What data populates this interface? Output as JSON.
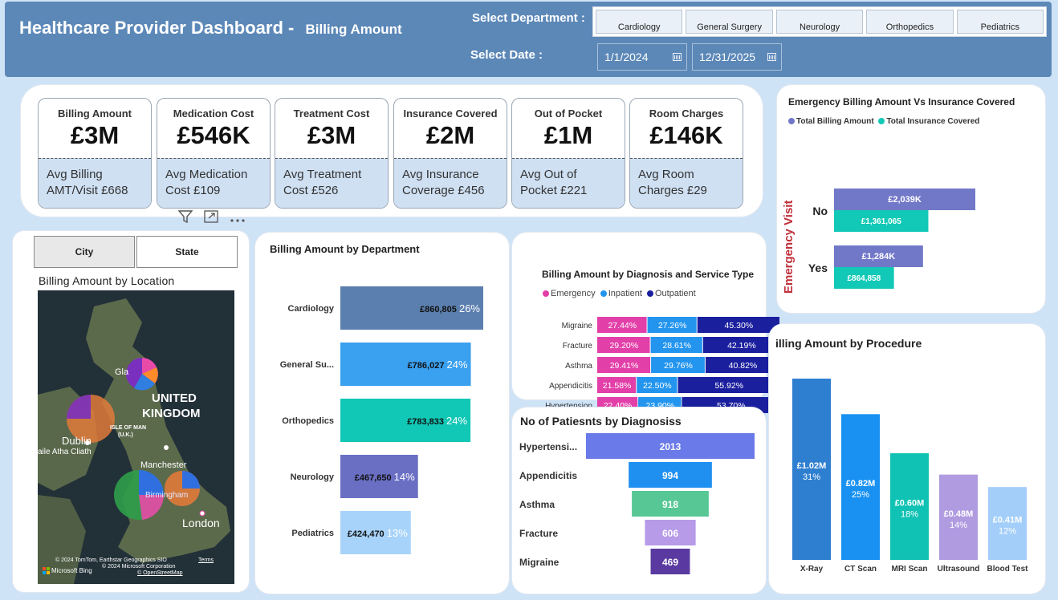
{
  "header": {
    "title_main": "Healthcare Provider Dashboard -",
    "title_sub": "Billing Amount",
    "select_department_label": "Select Department :",
    "select_date_label": "Select Date :",
    "departments": [
      "Cardiology",
      "General Surgery",
      "Neurology",
      "Orthopedics",
      "Pediatrics"
    ],
    "date_start": "1/1/2024",
    "date_end": "12/31/2025"
  },
  "kpis": [
    {
      "title": "Billing Amount",
      "value": "£3M",
      "avg": "Avg Billing AMT/Visit £668"
    },
    {
      "title": "Medication Cost",
      "value": "£546K",
      "avg": "Avg Medication Cost £109"
    },
    {
      "title": "Treatment Cost",
      "value": "£3M",
      "avg": "Avg Treatment Cost £526"
    },
    {
      "title": "Insurance Covered",
      "value": "£2M",
      "avg": "Avg Insurance Coverage £456"
    },
    {
      "title": "Out of Pocket",
      "value": "£1M",
      "avg": "Avg Out of Pocket £221"
    },
    {
      "title": "Room Charges",
      "value": "£146K",
      "avg": "Avg Room Charges £29"
    }
  ],
  "location": {
    "tabs": [
      "City",
      "State"
    ],
    "title": "Billing Amount by Location",
    "map_labels": {
      "uk1": "UNITED",
      "uk2": "KINGDOM",
      "isle1": "ISLE OF MAN",
      "isle2": "(U.K.)",
      "dublin": "Dublin",
      "baile": "aile Atha Cliath",
      "manchester": "Manchester",
      "birm": "Birmingham",
      "london": "London",
      "gla": "Gla",
      "copy1": "© 2024 TomTom, Earthstar Geographics SIO",
      "copy2": "© 2024 Microsoft Corporation",
      "terms": "Terms",
      "osm": "© OpenStreetMap",
      "bing": "Microsoft Bing"
    }
  },
  "colors": {
    "cardiology": "#5b7fae",
    "general_surgery": "#3aa0f0",
    "orthopedics": "#11c7b5",
    "neurology": "#6a6fc4",
    "pediatrics": "#a7d3fa",
    "emergency": "#e23fa8",
    "inpatient": "#2395ef",
    "outpatient": "#1a1f9e",
    "billing_total": "#7278c8",
    "insurance_total": "#12c9b7"
  },
  "chart_data": [
    {
      "type": "bar",
      "title": "Billing Amount by Department",
      "categories": [
        "Cardiology",
        "General Su...",
        "Orthopedics",
        "Neurology",
        "Pediatrics"
      ],
      "values": [
        860805,
        786027,
        783833,
        467650,
        424470
      ],
      "labels": [
        "£860,805",
        "£786,027",
        "£783,833",
        "£467,650",
        "£424,470"
      ],
      "percents": [
        "26%",
        "24%",
        "24%",
        "14%",
        "13%"
      ]
    },
    {
      "type": "bar",
      "title": "Billing Amount by Diagnosis and Service Type",
      "legend": [
        "Emergency",
        "Inpatient",
        "Outpatient"
      ],
      "categories": [
        "Migraine",
        "Fracture",
        "Asthma",
        "Appendicitis",
        "Hypertension"
      ],
      "series": [
        {
          "name": "Emergency",
          "values": [
            27.44,
            29.2,
            29.41,
            21.58,
            22.4
          ]
        },
        {
          "name": "Inpatient",
          "values": [
            27.26,
            28.61,
            29.76,
            22.5,
            23.9
          ]
        },
        {
          "name": "Outpatient",
          "values": [
            45.3,
            42.19,
            40.82,
            55.92,
            53.7
          ]
        }
      ]
    },
    {
      "type": "bar",
      "title": "No of Patiesnts by Diagnosiss",
      "categories": [
        "Hypertensi...",
        "Appendicitis",
        "Asthma",
        "Fracture",
        "Migraine"
      ],
      "values": [
        2013,
        994,
        918,
        606,
        469
      ],
      "colors": [
        "#6a7ae8",
        "#1f8ff0",
        "#57c795",
        "#b79ae8",
        "#5a3aa0"
      ]
    },
    {
      "type": "bar",
      "title": "Emergency Billing Amount Vs Insurance Covered",
      "axis_label": "Emergency Visit",
      "legend": [
        "Total Billing Amount",
        "Total Insurance Covered"
      ],
      "categories": [
        "No",
        "Yes"
      ],
      "series": [
        {
          "name": "Total Billing Amount",
          "values": [
            2039000,
            1284000
          ],
          "labels": [
            "£2,039K",
            "£1,284K"
          ]
        },
        {
          "name": "Total Insurance Covered",
          "values": [
            1361065,
            864858
          ],
          "labels": [
            "£1,361,065",
            "£864,858"
          ]
        }
      ]
    },
    {
      "type": "bar",
      "title": "illing Amount by Procedure",
      "categories": [
        "X-Ray",
        "CT Scan",
        "MRI Scan",
        "Ultrasound",
        "Blood Test"
      ],
      "values": [
        1.02,
        0.82,
        0.6,
        0.48,
        0.41
      ],
      "labels": [
        "£1.02M",
        "£0.82M",
        "£0.60M",
        "£0.48M",
        "£0.41M"
      ],
      "percents": [
        "31%",
        "25%",
        "18%",
        "14%",
        "12%"
      ],
      "colors": [
        "#2f7fd0",
        "#1891f2",
        "#10c2b4",
        "#b09be0",
        "#a3cef9"
      ]
    }
  ]
}
